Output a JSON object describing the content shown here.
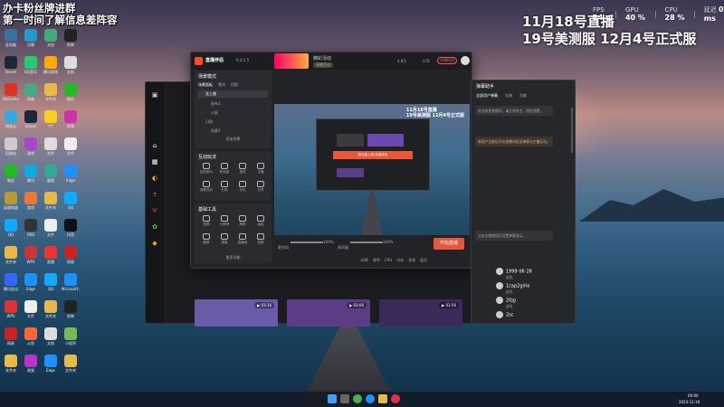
{
  "overlay": {
    "top_left": [
      "办卡粉丝牌进群",
      "第一时间了解信息差阵容"
    ],
    "top_right": [
      "11月18号直播",
      "19号美测服 12月4号正式服"
    ]
  },
  "perf": {
    "fps_label": "FPS",
    "fps": "24",
    "gpu_label": "GPU",
    "gpu": "40 %",
    "cpu_label": "CPU",
    "cpu": "28 %",
    "net_label": "延迟",
    "net": "0 ms"
  },
  "colors": {
    "accent": "#e8573a",
    "purple": "#6c5aa8",
    "dark": "#222327"
  },
  "main_window": {
    "title": "直播伴侣",
    "version": "6.4.1.5",
    "panel_header": "场景模式",
    "tabs": [
      "场景面板",
      "素材",
      "切换"
    ],
    "scene": "北上路",
    "items": [
      "画布1",
      "公屏",
      "日照",
      "场景2"
    ],
    "add_scene": "添加场景",
    "interact_header": "互动玩法",
    "interact": [
      "连线观众",
      "粉丝团",
      "抽奖",
      "主播",
      "观看时长",
      "礼物",
      "评论",
      "分享"
    ],
    "tools_header": "基础工具",
    "tools": [
      "拍照",
      "分辨率",
      "美颜",
      "画板",
      "截屏",
      "弹幕",
      "直播间",
      "投屏"
    ],
    "more": "更多功能",
    "ad_title": "精彩活动",
    "ad_sub": "直播活动",
    "stats": [
      "4.9万",
      "实时",
      "分享",
      "178",
      "在线"
    ],
    "mic": "麦克风",
    "mic_vol": "100%",
    "speaker": "扬声器",
    "speaker_vol": "100%",
    "btns": [
      "美颜",
      "设置",
      "特效",
      "更多"
    ],
    "live_btn": "开始直播",
    "status": [
      "码率",
      "帧率",
      "CPU",
      "内存",
      "丢帧",
      "延迟"
    ],
    "preview_overlay": [
      "11月18号直播",
      "19号美测服 12月4号正式服"
    ],
    "banner": "新功能上线 欢迎体验",
    "user": "小号",
    "user_btn": "开播检测",
    "user_btn2": "设置"
  },
  "right_panel": {
    "title": "弹幕助手",
    "tabs": [
      "全部用户弹幕",
      "礼物",
      "贡献"
    ],
    "bubble1": "欢迎来到直播间，请文明发言，理性消费。",
    "bubble2": "新用户注册后可在直播间发送弹幕与主播互动。",
    "bubble3": "点击右侧按钮可设置弹幕显示。",
    "gifts": [
      {
        "name": "1999 06 28",
        "sub": "送礼"
      },
      {
        "name": "1cap2girlo",
        "sub": "送礼"
      },
      {
        "name": "20jg",
        "sub": "送礼"
      },
      {
        "name": "2sc",
        "sub": ""
      }
    ],
    "btn": "设置"
  },
  "desktop_icons": [
    "此电脑",
    "Steam",
    "WeGame",
    "网易云",
    "回收站",
    "微信",
    "英雄联盟",
    "QQ",
    "文件夹",
    "腾讯会议",
    "WPS",
    "网易",
    "文件夹",
    "迅雷",
    "QQ音乐",
    "网络",
    "Steam",
    "游戏",
    "腾讯",
    "游戏",
    "OBS",
    "WPS",
    "Edge",
    "文件",
    "斗鱼",
    "视频",
    "文档",
    "腾讯视频",
    "文件夹",
    "YY",
    "文件",
    "截图",
    "文件夹",
    "文件",
    "直播",
    "QQ",
    "文件夹",
    "文档",
    "Edge",
    "剪映",
    "文档",
    "微信",
    "视频",
    "文件",
    "Edge",
    "QQ",
    "抖音",
    "网易",
    "Microsoft Edge",
    "剪映",
    "小程序",
    "文件夹"
  ],
  "taskbar": {
    "time": "00:00",
    "date": "2023-11-18"
  }
}
